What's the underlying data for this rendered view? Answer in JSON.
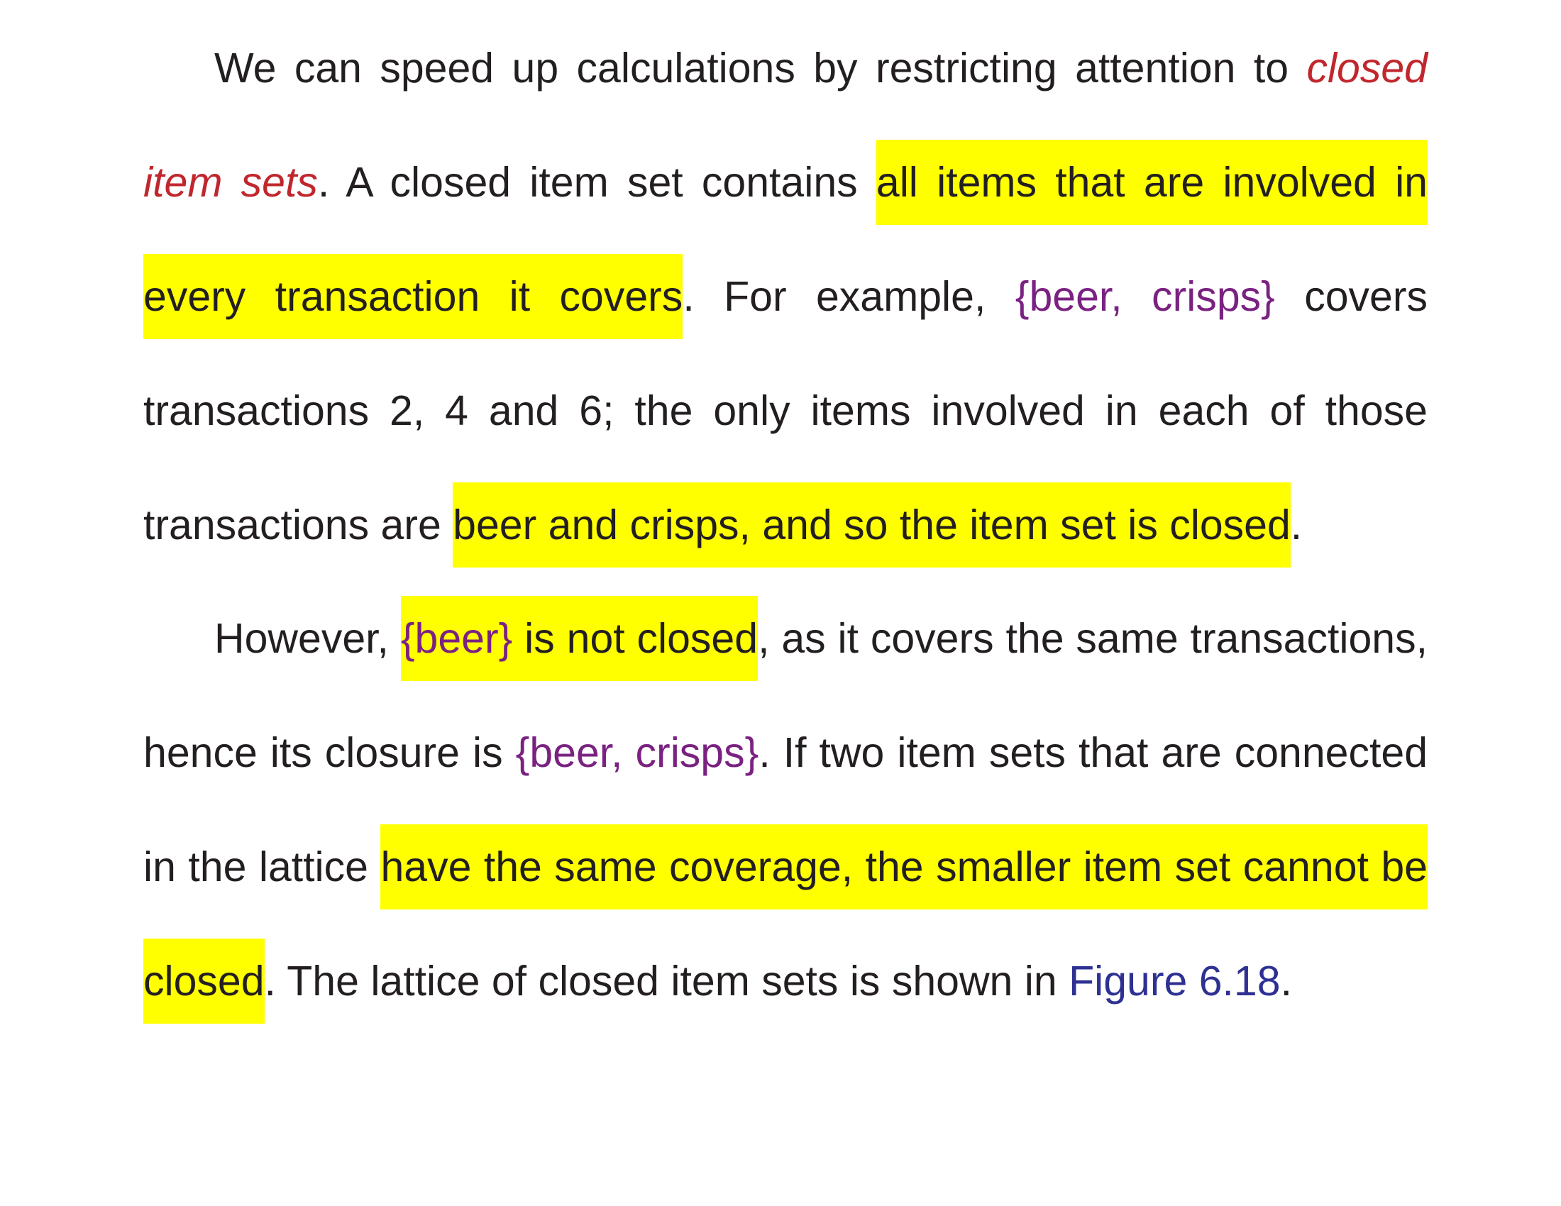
{
  "colors": {
    "text": "#231f20",
    "highlight": "#ffff00",
    "term": "#c0272d",
    "set": "#7a2281",
    "reference": "#2e3192"
  },
  "paragraph1": {
    "s1": "We can speed up calculations by restricting attention to ",
    "term": "closed item sets",
    "s2": ". A closed item set contains ",
    "hl1": "all items that are involved in every transaction it covers",
    "s3": ". For example, ",
    "set1": "{beer, crisps}",
    "s4": " covers transactions 2, 4 and 6; the only items involved in each of those transactions are ",
    "hl2": "beer and crisps, and so the item set is closed",
    "s5": "."
  },
  "paragraph2": {
    "s1": "However, ",
    "hl1_set": "{beer}",
    "hl1_text": " is not closed",
    "s2": ", as it covers the same transactions, hence its closure is ",
    "set1": "{beer, crisps}",
    "s3": ". If two item sets that are connected in the lattice ",
    "hl2": "have the same coverage, the smaller item set cannot be closed",
    "s4": ". The lattice of closed item sets is shown in ",
    "figure_ref": "Figure 6.18",
    "s5": "."
  }
}
